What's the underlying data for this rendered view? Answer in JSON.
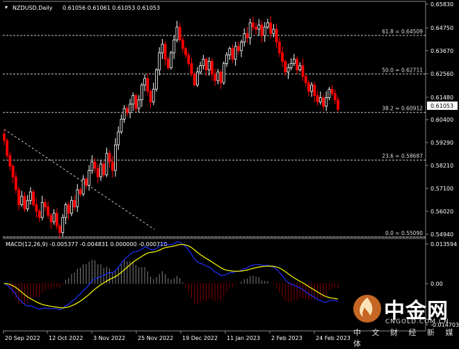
{
  "header": {
    "symbol_label": "NZDUSD,Daily",
    "ohlc_label": "0.61056 0.61061 0.61053 0.61053"
  },
  "current_price_label": "0.61053",
  "colors": {
    "background": "#000000",
    "bull_candle": "#ffffff",
    "bear_candle": "#ff0000",
    "fib_line": "#c8c8c8",
    "macd_line": "#1f2fff",
    "signal_line": "#ffff00",
    "hist_positive": "#ffffff",
    "hist_negative": "#ff0000"
  },
  "price_axis": {
    "min": 0.5525,
    "max": 0.6594,
    "ticks": [
      "0.65830",
      "0.64750",
      "0.63670",
      "0.62560",
      "0.61480",
      "0.60400",
      "0.59290",
      "0.58210",
      "0.57100",
      "0.56020",
      "0.54940"
    ]
  },
  "fib_levels": [
    {
      "label": "61.8 = 0.64509",
      "value": 0.64509
    },
    {
      "label": "50.0 = 0.62711",
      "value": 0.62711
    },
    {
      "label": "38.2 = 0.60912",
      "value": 0.60912
    },
    {
      "label": "23.6 = 0.58687",
      "value": 0.58687
    },
    {
      "label": "0.0 = 0.55090",
      "value": 0.5509
    }
  ],
  "macd": {
    "label": "MACD(12,26,9) -0.005377 -0.004831 0.000000 -0.000710",
    "axis_min": -0.0152,
    "axis_max": 0.0141,
    "ticks": [
      "0.013594",
      "0.00",
      "-0.014703"
    ]
  },
  "x_axis": {
    "labels": [
      "20 Sep 2022",
      "12 Oct 2022",
      "3 Nov 2022",
      "25 Nov 2022",
      "19 Dec 2022",
      "11 Jan 2023",
      "2 Feb 2023",
      "24 Feb 2023"
    ]
  },
  "watermark": {
    "text": "中金网",
    "url": "CNGOLD.COM.CN",
    "subtitle": "中 文 财 经 新 媒 体",
    "icon": "flame-logo-icon"
  },
  "chart_data": {
    "type": "candlestick",
    "title": "NZDUSD,Daily",
    "ylim": [
      0.5525,
      0.6594
    ],
    "closes": [
      0.596,
      0.589,
      0.584,
      0.579,
      0.573,
      0.566,
      0.57,
      0.564,
      0.568,
      0.572,
      0.566,
      0.563,
      0.56,
      0.567,
      0.565,
      0.561,
      0.558,
      0.562,
      0.556,
      0.553,
      0.56,
      0.566,
      0.562,
      0.568,
      0.565,
      0.573,
      0.571,
      0.578,
      0.575,
      0.582,
      0.586,
      0.583,
      0.579,
      0.585,
      0.58,
      0.59,
      0.586,
      0.582,
      0.594,
      0.6,
      0.606,
      0.611,
      0.609,
      0.613,
      0.617,
      0.611,
      0.615,
      0.622,
      0.625,
      0.619,
      0.614,
      0.62,
      0.629,
      0.637,
      0.641,
      0.634,
      0.63,
      0.637,
      0.643,
      0.649,
      0.643,
      0.639,
      0.636,
      0.632,
      0.627,
      0.622,
      0.628,
      0.631,
      0.634,
      0.629,
      0.633,
      0.627,
      0.624,
      0.628,
      0.623,
      0.632,
      0.636,
      0.639,
      0.634,
      0.64,
      0.638,
      0.642,
      0.646,
      0.644,
      0.651,
      0.649,
      0.648,
      0.65,
      0.645,
      0.649,
      0.651,
      0.646,
      0.648,
      0.642,
      0.637,
      0.633,
      0.628,
      0.63,
      0.632,
      0.634,
      0.629,
      0.631,
      0.626,
      0.623,
      0.619,
      0.622,
      0.617,
      0.614,
      0.616,
      0.612,
      0.616,
      0.62,
      0.618,
      0.615,
      0.61053
    ]
  }
}
